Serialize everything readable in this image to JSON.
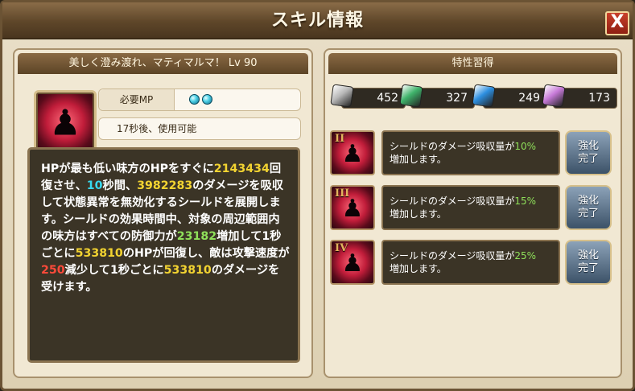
{
  "dialog": {
    "title": "スキル情報",
    "close_label": "X"
  },
  "skill": {
    "header": "美しく澄み渡れ、マティマルマ！ Lv 90",
    "icon": "shield-figure-icon",
    "mp_label": "必要MP",
    "mp_cost": 2,
    "cooldown": "17秒後、使用可能",
    "description_parts": [
      {
        "t": "HPが最も低い味方のHPをすぐに",
        "c": ""
      },
      {
        "t": "2143434",
        "c": "yellow"
      },
      {
        "t": "回復させ、",
        "c": ""
      },
      {
        "t": "10",
        "c": "cyan"
      },
      {
        "t": "秒間、",
        "c": ""
      },
      {
        "t": "3982283",
        "c": "yellow"
      },
      {
        "t": "のダメージを吸収して状態異常を無効化するシールドを展開します。シールドの効果時間中、対象の周辺範囲内の味方はすべての防御力が",
        "c": ""
      },
      {
        "t": "23182",
        "c": "green"
      },
      {
        "t": "増加して1秒ごとに",
        "c": ""
      },
      {
        "t": "533810",
        "c": "yellow"
      },
      {
        "t": "のHPが回復し、敵は攻撃速度が",
        "c": ""
      },
      {
        "t": "250",
        "c": "red"
      },
      {
        "t": "減少して1秒ごとに",
        "c": ""
      },
      {
        "t": "533810",
        "c": "yellow"
      },
      {
        "t": "のダメージを受けます。",
        "c": ""
      }
    ]
  },
  "traits": {
    "header": "特性習得",
    "resources": [
      {
        "icon": "silver-book-icon",
        "value": "452",
        "color": "#b8b8b8"
      },
      {
        "icon": "green-book-icon",
        "value": "327",
        "color": "#3fb36b"
      },
      {
        "icon": "blue-book-icon",
        "value": "249",
        "color": "#2d8fe0"
      },
      {
        "icon": "purple-book-icon",
        "value": "173",
        "color": "#c77ad8"
      }
    ],
    "items": [
      {
        "numeral": "II",
        "text_before": "シールドのダメージ吸収量が",
        "value": "10%",
        "text_after": "増加します。",
        "button": "強化\n完了"
      },
      {
        "numeral": "III",
        "text_before": "シールドのダメージ吸収量が",
        "value": "15%",
        "text_after": "増加します。",
        "button": "強化\n完了"
      },
      {
        "numeral": "IV",
        "text_before": "シールドのダメージ吸収量が",
        "value": "25%",
        "text_after": "増加します。",
        "button": "強化\n完了"
      }
    ]
  }
}
